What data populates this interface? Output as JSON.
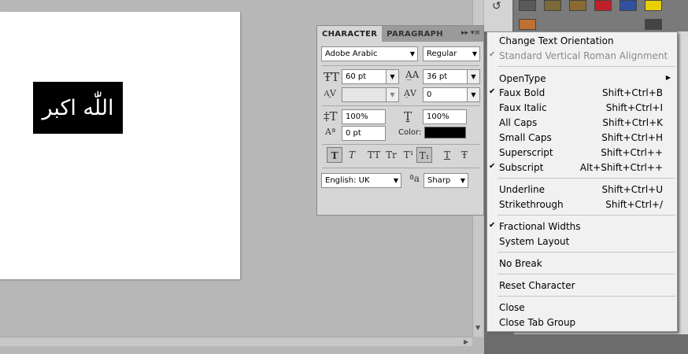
{
  "canvas": {
    "text": "اللّٰه اكبر"
  },
  "character_panel": {
    "tabs": [
      "CHARACTER",
      "PARAGRAPH"
    ],
    "font_family": "Adobe Arabic",
    "font_style": "Regular",
    "font_size": "60 pt",
    "leading": "36 pt",
    "kerning": "",
    "tracking": "0",
    "vertical_scale": "100%",
    "horizontal_scale": "100%",
    "baseline_shift": "0 pt",
    "color_label": "Color:",
    "color": "#000000",
    "language": "English: UK",
    "antialias": "Sharp",
    "style_buttons": [
      "T",
      "T",
      "TT",
      "Tr",
      "T¹",
      "T₁",
      "T",
      "Ŧ"
    ]
  },
  "menu": {
    "items": [
      {
        "label": "Change Text Orientation",
        "shortcut": ""
      },
      {
        "label": "Standard Vertical Roman Alignment",
        "shortcut": "",
        "checked": true,
        "disabled": true
      },
      {
        "label": "OpenType",
        "shortcut": "",
        "submenu": true
      },
      {
        "label": "Faux Bold",
        "shortcut": "Shift+Ctrl+B",
        "checked": true
      },
      {
        "label": "Faux Italic",
        "shortcut": "Shift+Ctrl+I"
      },
      {
        "label": "All Caps",
        "shortcut": "Shift+Ctrl+K"
      },
      {
        "label": "Small Caps",
        "shortcut": "Shift+Ctrl+H"
      },
      {
        "label": "Superscript",
        "shortcut": "Shift+Ctrl++"
      },
      {
        "label": "Subscript",
        "shortcut": "Alt+Shift+Ctrl++",
        "checked": true
      },
      {
        "label": "Underline",
        "shortcut": "Shift+Ctrl+U"
      },
      {
        "label": "Strikethrough",
        "shortcut": "Shift+Ctrl+/"
      },
      {
        "label": "Fractional Widths",
        "shortcut": "",
        "checked": true
      },
      {
        "label": "System Layout",
        "shortcut": ""
      },
      {
        "label": "No Break",
        "shortcut": ""
      },
      {
        "label": "Reset Character",
        "shortcut": ""
      },
      {
        "label": "Close",
        "shortcut": ""
      },
      {
        "label": "Close Tab Group",
        "shortcut": ""
      }
    ]
  }
}
